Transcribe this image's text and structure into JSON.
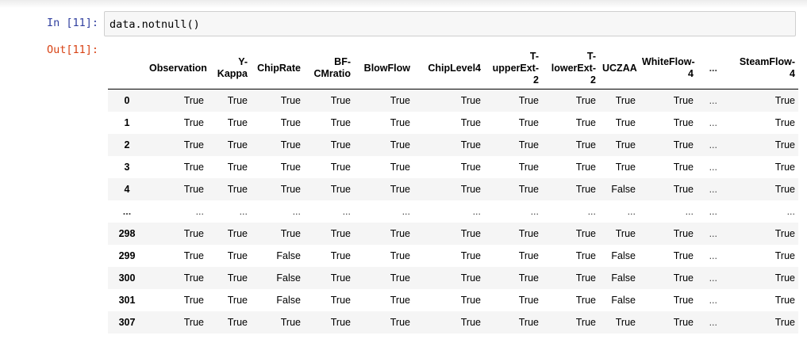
{
  "input_prompt": "In [11]:",
  "output_prompt": "Out[11]:",
  "code": "data.notnull()",
  "table": {
    "columns": [
      "",
      "Observation",
      "Y-\nKappa",
      "ChipRate",
      "BF-\nCMratio",
      "BlowFlow",
      "ChipLevel4",
      "T-\nupperExt-\n2",
      "T-\nlowerExt-\n2",
      "UCZAA",
      "WhiteFlow-\n4",
      "...",
      "SteamFlow-\n4"
    ],
    "rows": [
      [
        "0",
        "True",
        "True",
        "True",
        "True",
        "True",
        "True",
        "True",
        "True",
        "True",
        "True",
        "...",
        "True"
      ],
      [
        "1",
        "True",
        "True",
        "True",
        "True",
        "True",
        "True",
        "True",
        "True",
        "True",
        "True",
        "...",
        "True"
      ],
      [
        "2",
        "True",
        "True",
        "True",
        "True",
        "True",
        "True",
        "True",
        "True",
        "True",
        "True",
        "...",
        "True"
      ],
      [
        "3",
        "True",
        "True",
        "True",
        "True",
        "True",
        "True",
        "True",
        "True",
        "True",
        "True",
        "...",
        "True"
      ],
      [
        "4",
        "True",
        "True",
        "True",
        "True",
        "True",
        "True",
        "True",
        "True",
        "False",
        "True",
        "...",
        "True"
      ],
      [
        "...",
        "...",
        "...",
        "...",
        "...",
        "...",
        "...",
        "...",
        "...",
        "...",
        "...",
        "...",
        "..."
      ],
      [
        "298",
        "True",
        "True",
        "True",
        "True",
        "True",
        "True",
        "True",
        "True",
        "True",
        "True",
        "...",
        "True"
      ],
      [
        "299",
        "True",
        "True",
        "False",
        "True",
        "True",
        "True",
        "True",
        "True",
        "False",
        "True",
        "...",
        "True"
      ],
      [
        "300",
        "True",
        "True",
        "False",
        "True",
        "True",
        "True",
        "True",
        "True",
        "False",
        "True",
        "...",
        "True"
      ],
      [
        "301",
        "True",
        "True",
        "False",
        "True",
        "True",
        "True",
        "True",
        "True",
        "False",
        "True",
        "...",
        "True"
      ],
      [
        "307",
        "True",
        "True",
        "True",
        "True",
        "True",
        "True",
        "True",
        "True",
        "True",
        "True",
        "...",
        "True"
      ]
    ]
  }
}
